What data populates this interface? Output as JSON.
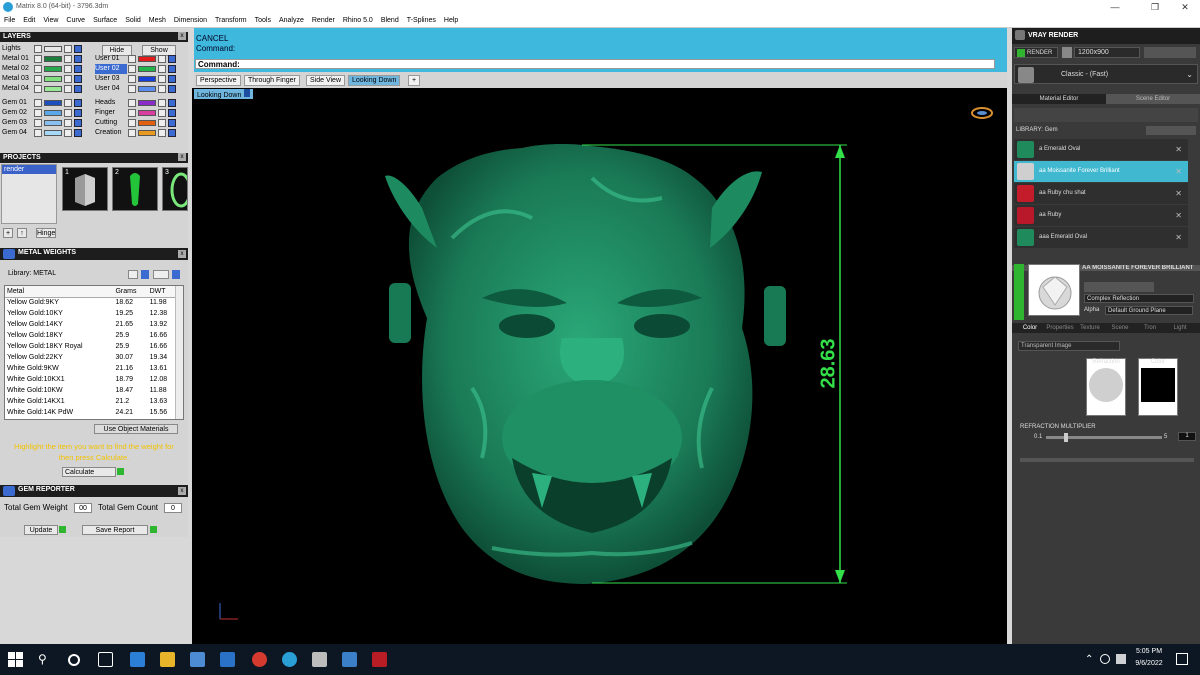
{
  "window": {
    "title": "Matrix 8.0 (64-bit) - 3796.3dm"
  },
  "menu": [
    "File",
    "Edit",
    "View",
    "Curve",
    "Surface",
    "Solid",
    "Mesh",
    "Dimension",
    "Transform",
    "Tools",
    "Analyze",
    "Render",
    "Rhino 5.0",
    "Blend",
    "T-Splines",
    "Help"
  ],
  "layers": {
    "title": "LAYERS",
    "lights": "Lights",
    "hide": "Hide",
    "show": "Show",
    "left": [
      {
        "name": "Metal 01",
        "color": "#1a7d3c"
      },
      {
        "name": "Metal 02",
        "color": "#27a84c"
      },
      {
        "name": "Metal 03",
        "color": "#7fdf7f"
      },
      {
        "name": "Metal 04",
        "color": "#98e898"
      },
      {
        "name": "Gem 01",
        "color": "#1e4fbf"
      },
      {
        "name": "Gem 02",
        "color": "#5aa8e8"
      },
      {
        "name": "Gem 03",
        "color": "#88c0f0"
      },
      {
        "name": "Gem 04",
        "color": "#a8d8f8"
      }
    ],
    "right": [
      {
        "name": "User 01",
        "color": "#e51b1b"
      },
      {
        "name": "User 02",
        "color": "#22b34a",
        "selected": true
      },
      {
        "name": "User 03",
        "color": "#1640d8"
      },
      {
        "name": "User 04",
        "color": "#5a8cf0"
      },
      {
        "name": "Heads",
        "color": "#8a2cc8"
      },
      {
        "name": "Finger",
        "color": "#d83ca0"
      },
      {
        "name": "Cutting",
        "color": "#e06010"
      },
      {
        "name": "Creation",
        "color": "#e89a20"
      }
    ]
  },
  "projects": {
    "title": "PROJECTS",
    "item": "render",
    "thumbs": [
      "1",
      "2",
      "3"
    ],
    "hinge": "Hinge"
  },
  "metal_weights": {
    "title": "METAL WEIGHTS",
    "library_label": "Library: METAL",
    "columns": [
      "Metal",
      "Grams",
      "DWT"
    ],
    "rows": [
      [
        "Yellow Gold:9KY",
        "18.62",
        "11.98"
      ],
      [
        "Yellow Gold:10KY",
        "19.25",
        "12.38"
      ],
      [
        "Yellow Gold:14KY",
        "21.65",
        "13.92"
      ],
      [
        "Yellow Gold:18KY",
        "25.9",
        "16.66"
      ],
      [
        "Yellow Gold:18KY Royal",
        "25.9",
        "16.66"
      ],
      [
        "Yellow Gold:22KY",
        "30.07",
        "19.34"
      ],
      [
        "White Gold:9KW",
        "21.16",
        "13.61"
      ],
      [
        "White Gold:10KX1",
        "18.79",
        "12.08"
      ],
      [
        "White Gold:10KW",
        "18.47",
        "11.88"
      ],
      [
        "White Gold:14KX1",
        "21.2",
        "13.63"
      ],
      [
        "White Gold:14K PdW",
        "24.21",
        "15.56"
      ]
    ],
    "use_object_materials": "Use Object Materials",
    "hint": "Highlight the item you want to find the weight for then press Calculate.",
    "calculate": "Calculate"
  },
  "gem_reporter": {
    "title": "GEM REPORTER",
    "total_weight_label": "Total Gem Weight",
    "total_weight_value": "00",
    "total_count_label": "Total Gem Count",
    "total_count_value": "0",
    "update": "Update",
    "save_report": "Save Report"
  },
  "command": {
    "line1": "CANCEL",
    "line2": "Command:",
    "prompt": "Command:"
  },
  "view_tabs": [
    "Perspective",
    "Through Finger",
    "Side View",
    "Looking Down"
  ],
  "active_view": "Looking Down",
  "view_label": "Looking Down",
  "viewport": {
    "dimension": "28.63",
    "model_color": "#1f8a64",
    "dim_color": "#33e04a"
  },
  "vray": {
    "title": "VRAY RENDER",
    "render_btn": "RENDER",
    "resolution": "1200x900",
    "quality_label": "Classic - (Fast)",
    "tabs": [
      "Material Editor",
      "Scene Editor"
    ],
    "library": "LIBRARY: Gem",
    "materials": [
      {
        "name": "a Emerald Oval",
        "color": "#1f8a5c"
      },
      {
        "name": "aa Moissanite Forever Brilliant",
        "color": "#cfcfcf",
        "selected": true
      },
      {
        "name": "aa Ruby chu shat",
        "color": "#c41c2a"
      },
      {
        "name": "aa Ruby",
        "color": "#b8182a"
      },
      {
        "name": "aaa Emerald Oval",
        "color": "#1f8a5c"
      }
    ],
    "selected_name": "AA MOISSANITE FOREVER BRILLIANT",
    "complex_reflection": "Complex Reflection",
    "alpha": "Alpha",
    "default_ground": "Default Ground Plane",
    "subtabs": [
      "Color",
      "Properties",
      "Texture",
      "Scene",
      "Tron",
      "Light"
    ],
    "transparent_image": "Transparent Image",
    "refraction": "Refraction",
    "color": "Color",
    "refraction_multiplier": "REFRACTION MULTIPLIER",
    "min": "0.1",
    "max": "5",
    "mult_value": "1"
  },
  "taskbar": {
    "time": "5:05 PM",
    "date": "9/6/2022"
  }
}
